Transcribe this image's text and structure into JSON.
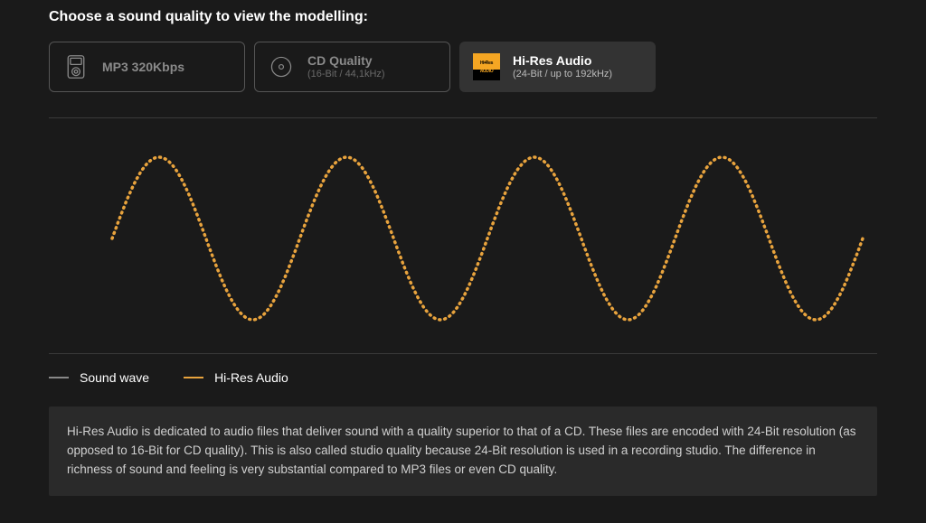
{
  "heading": "Choose a sound quality to view the modelling:",
  "tabs": [
    {
      "title": "MP3 320Kbps",
      "sub": "",
      "selected": false,
      "icon": "mp3"
    },
    {
      "title": "CD Quality",
      "sub": "(16-Bit / 44,1kHz)",
      "selected": false,
      "icon": "cd"
    },
    {
      "title": "Hi-Res Audio",
      "sub": "(24-Bit / up to 192kHz)",
      "selected": true,
      "icon": "hires"
    }
  ],
  "legend": {
    "soundwave": "Sound wave",
    "hires": "Hi-Res Audio"
  },
  "description": "Hi-Res Audio is dedicated to audio files that deliver sound with a quality superior to that of a CD. These files are encoded with 24-Bit resolution (as opposed to 16-Bit for CD quality). This is also called studio quality because 24-Bit resolution is used in a recording studio. The difference in richness of sound and feeling is very substantial compared to MP3 files or even CD quality.",
  "colors": {
    "waveOrange": "#e8a33d",
    "waveGrey": "#888888"
  }
}
